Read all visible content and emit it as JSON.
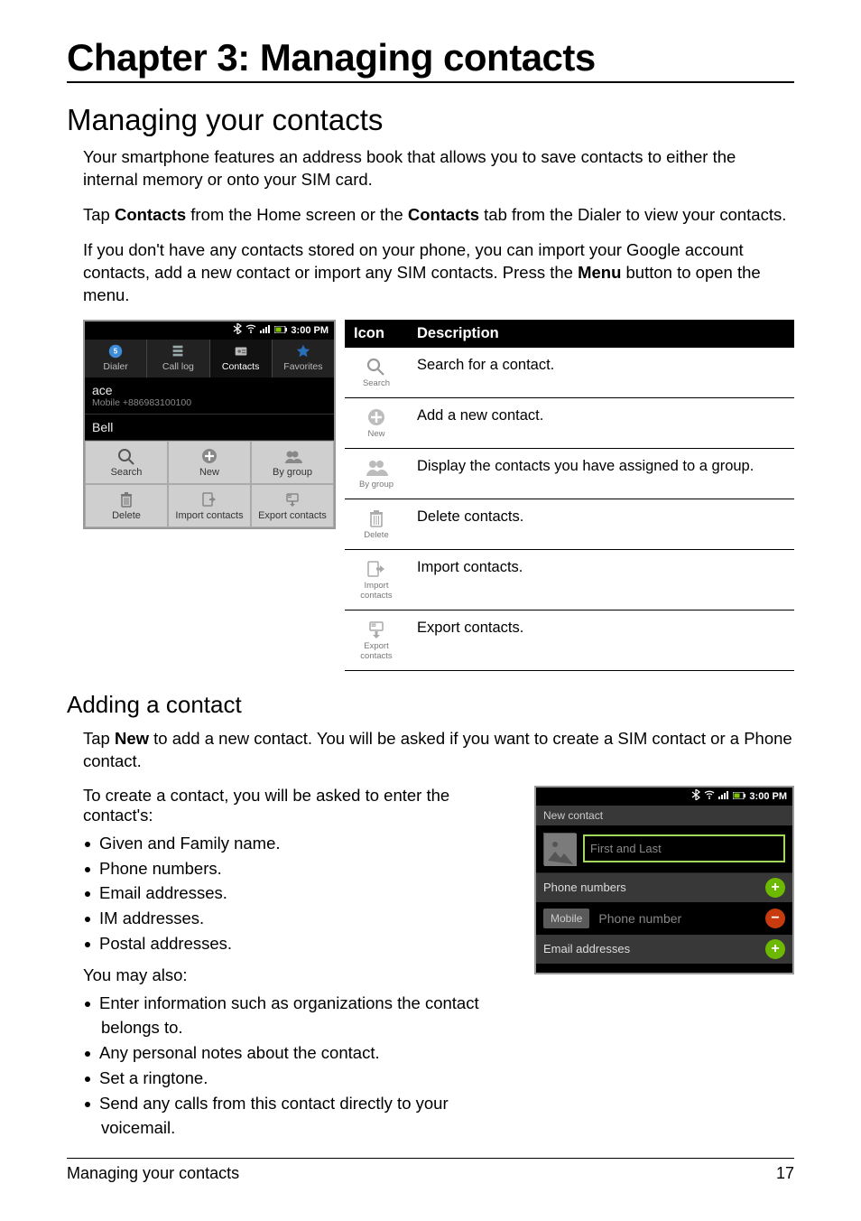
{
  "chapter_title": "Chapter 3: Managing contacts",
  "section_title": "Managing your contacts",
  "para1": "Your smartphone features an address book that allows you to save contacts to either the internal memory or onto your SIM card.",
  "para2_a": "Tap ",
  "para2_b": "Contacts",
  "para2_c": " from the Home screen or the ",
  "para2_d": "Contacts",
  "para2_e": " tab from the Dialer to view your contacts.",
  "para3_a": "If you don't have any contacts stored on your phone, you can import your Google account contacts, add a new contact or import any SIM contacts. Press the ",
  "para3_b": "Menu",
  "para3_c": " button to open the menu.",
  "status_time": "3:00 PM",
  "tabs": {
    "dialer": "Dialer",
    "call_log": "Call log",
    "contacts": "Contacts",
    "favorites": "Favorites"
  },
  "contact_list": {
    "row1_name": "ace",
    "row1_sub": "Mobile +886983100100",
    "row2_name": "Bell"
  },
  "menu": {
    "search": "Search",
    "new": "New",
    "by_group": "By group",
    "delete": "Delete",
    "import": "Import contacts",
    "export": "Export contacts"
  },
  "table": {
    "hdr_icon": "Icon",
    "hdr_desc": "Description",
    "rows": [
      {
        "label": "Search",
        "desc": "Search for a contact."
      },
      {
        "label": "New",
        "desc": "Add a new contact."
      },
      {
        "label": "By group",
        "desc": "Display the contacts you have assigned to a group."
      },
      {
        "label": "Delete",
        "desc": "Delete contacts."
      },
      {
        "label": "Import contacts",
        "desc": "Import contacts."
      },
      {
        "label": "Export contacts",
        "desc": "Export contacts."
      }
    ]
  },
  "subsection_title": "Adding a contact",
  "add_para1_a": "Tap ",
  "add_para1_b": "New",
  "add_para1_c": " to add a new contact. You will be asked if you want to create a SIM contact or a Phone contact.",
  "add_para2": "To create a contact, you will be asked to enter the contact's:",
  "bullets1": [
    "Given and Family name.",
    "Phone numbers.",
    "Email addresses.",
    "IM addresses.",
    "Postal addresses."
  ],
  "add_para3": "You may also:",
  "bullets2": [
    "Enter information such as organizations the contact belongs to.",
    "Any personal notes about the contact.",
    "Set a ringtone.",
    "Send any calls from this contact directly to your voicemail."
  ],
  "new_contact": {
    "title": "New contact",
    "name_placeholder": "First and Last",
    "phone_header": "Phone numbers",
    "phone_type": "Mobile",
    "phone_placeholder": "Phone number",
    "email_header": "Email addresses"
  },
  "footer": {
    "left": "Managing your contacts",
    "right": "17"
  }
}
